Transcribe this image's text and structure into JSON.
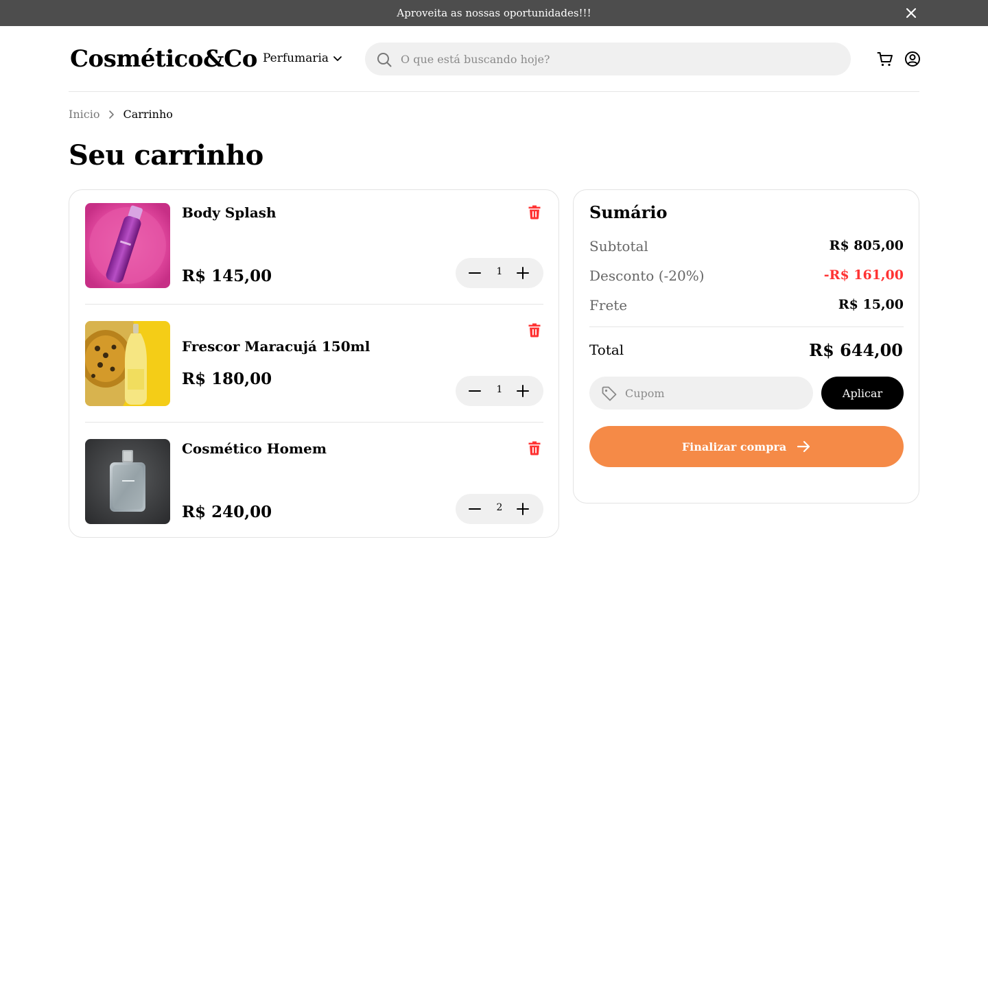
{
  "promo": {
    "text": "Aproveita as nossas oportunidades!!!"
  },
  "header": {
    "logo": "Cosmético&Co",
    "nav_label": "Perfumaria",
    "search_placeholder": "O que está buscando hoje?"
  },
  "breadcrumb": {
    "home": "Inicio",
    "current": "Carrinho"
  },
  "page": {
    "title": "Seu carrinho"
  },
  "cart": {
    "items": [
      {
        "name": "Body Splash",
        "price": "R$ 145,00",
        "quantity": "1"
      },
      {
        "name": " Frescor Maracujá 150ml",
        "price": "R$ 180,00",
        "quantity": "1"
      },
      {
        "name": "Cosmético Homem",
        "price": "R$ 240,00",
        "quantity": "2"
      }
    ]
  },
  "summary": {
    "title": "Sumário",
    "subtotal_label": "Subtotal",
    "subtotal_value": "R$ 805,00",
    "discount_label": "Desconto (-20%)",
    "discount_value": "-R$ 161,00",
    "shipping_label": "Frete",
    "shipping_value": "R$ 15,00",
    "total_label": "Total",
    "total_value": "R$ 644,00",
    "coupon_placeholder": "Cupom",
    "apply_label": "Aplicar",
    "checkout_label": "Finalizar compra"
  },
  "colors": {
    "promo_bar": "#4d4d4d",
    "accent_checkout": "#f58a47",
    "discount": "#ff3333",
    "trash": "#ff3333",
    "input_bg": "#f0f0f0"
  }
}
